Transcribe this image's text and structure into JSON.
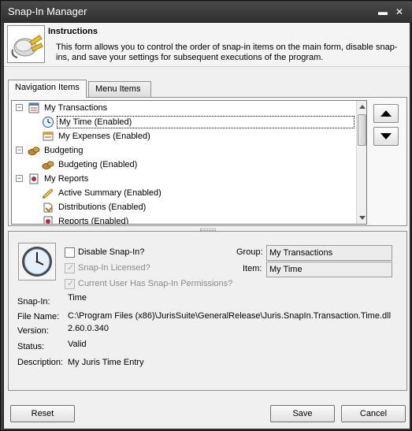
{
  "window": {
    "title": "Snap-In Manager",
    "minimize_glyph": "▬",
    "close_glyph": "✕"
  },
  "instructions": {
    "heading": "Instructions",
    "body": "This form allows you to control the order of snap-in items on the main form, disable snap-ins, and save your settings for subsequent executions of the program."
  },
  "tabs": [
    {
      "label": "Navigation Items",
      "active": true
    },
    {
      "label": "Menu Items",
      "active": false
    }
  ],
  "tree": {
    "items": [
      {
        "label": "My Transactions",
        "level": 0,
        "icon": "transactions-icon",
        "expander": "−"
      },
      {
        "label": "My Time (Enabled)",
        "level": 1,
        "icon": "clock-icon",
        "selected": true
      },
      {
        "label": "My Expenses (Enabled)",
        "level": 1,
        "icon": "expenses-icon"
      },
      {
        "label": "Budgeting",
        "level": 0,
        "icon": "budget-icon",
        "expander": "−"
      },
      {
        "label": "Budgeting (Enabled)",
        "level": 1,
        "icon": "budget-icon"
      },
      {
        "label": "My Reports",
        "level": 0,
        "icon": "reports-icon",
        "expander": "−"
      },
      {
        "label": "Active Summary (Enabled)",
        "level": 1,
        "icon": "summary-icon"
      },
      {
        "label": "Distributions (Enabled)",
        "level": 1,
        "icon": "distributions-icon"
      },
      {
        "label": "Reports (Enabled)",
        "level": 1,
        "icon": "reports-icon"
      }
    ]
  },
  "details": {
    "disable_snapin_label": "Disable Snap-In?",
    "licensed_label": "Snap-In Licensed?",
    "permissions_label": "Current User Has Snap-In Permissions?",
    "group_label": "Group:",
    "group_value": "My Transactions",
    "item_label": "Item:",
    "item_value": "My Time",
    "snapin_label": "Snap-In:",
    "snapin_value": "Time",
    "filename_label": "File Name:",
    "filename_value": "C:\\Program Files (x86)\\JurisSuite\\GeneralRelease\\Juris.SnapIn.Transaction.Time.dll",
    "version_label": "Version:",
    "version_value": "2.60.0.340",
    "status_label": "Status:",
    "status_value": "Valid",
    "description_label": "Description:",
    "description_value": "My Juris Time Entry"
  },
  "footer": {
    "reset_label": "Reset",
    "save_label": "Save",
    "cancel_label": "Cancel"
  }
}
